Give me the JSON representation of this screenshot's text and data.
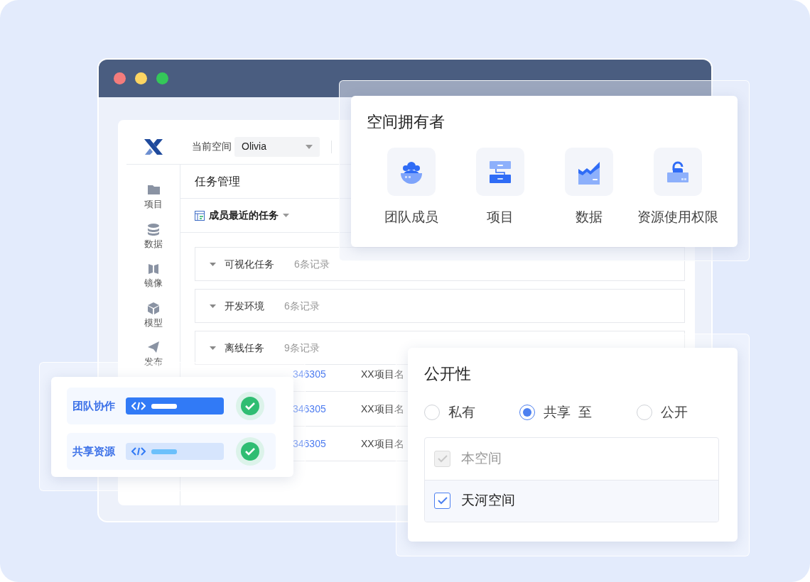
{
  "window": {
    "controls": [
      {
        "color": "#f47c7c"
      },
      {
        "color": "#fdd562"
      },
      {
        "color": "#34c759"
      }
    ]
  },
  "app": {
    "space_label": "当前空间",
    "space_value": "Olivia",
    "sidebar": [
      {
        "label": "项目"
      },
      {
        "label": "数据"
      },
      {
        "label": "镜像"
      },
      {
        "label": "模型"
      },
      {
        "label": "发布"
      }
    ],
    "page_title": "任务管理",
    "view": "成员最近的任务",
    "groups": [
      {
        "name": "可视化任务",
        "count": "6条记录"
      },
      {
        "name": "开发环境",
        "count": "6条记录"
      },
      {
        "name": "离线任务",
        "count": "9条记录"
      }
    ],
    "rows": [
      {
        "id": "346305",
        "project": "XX项目名"
      },
      {
        "id": "346305",
        "project": "XX项目名"
      },
      {
        "id": "346305",
        "project": "XX项目名"
      }
    ]
  },
  "owner_panel": {
    "title": "空间拥有者",
    "items": [
      {
        "label": "团队成员"
      },
      {
        "label": "项目"
      },
      {
        "label": "数据"
      },
      {
        "label": "资源使用权限"
      }
    ]
  },
  "visibility_panel": {
    "title": "公开性",
    "options": [
      {
        "label": "私有",
        "selected": false
      },
      {
        "label": "共享  至",
        "selected": true
      },
      {
        "label": "公开",
        "selected": false
      }
    ],
    "spaces": [
      {
        "label": "本空间",
        "checked": true,
        "disabled": true
      },
      {
        "label": "天河空间",
        "checked": true,
        "disabled": false
      }
    ]
  },
  "share_card": {
    "items": [
      {
        "label": "团队协作",
        "selected": true
      },
      {
        "label": "共享资源",
        "selected": false
      }
    ]
  }
}
